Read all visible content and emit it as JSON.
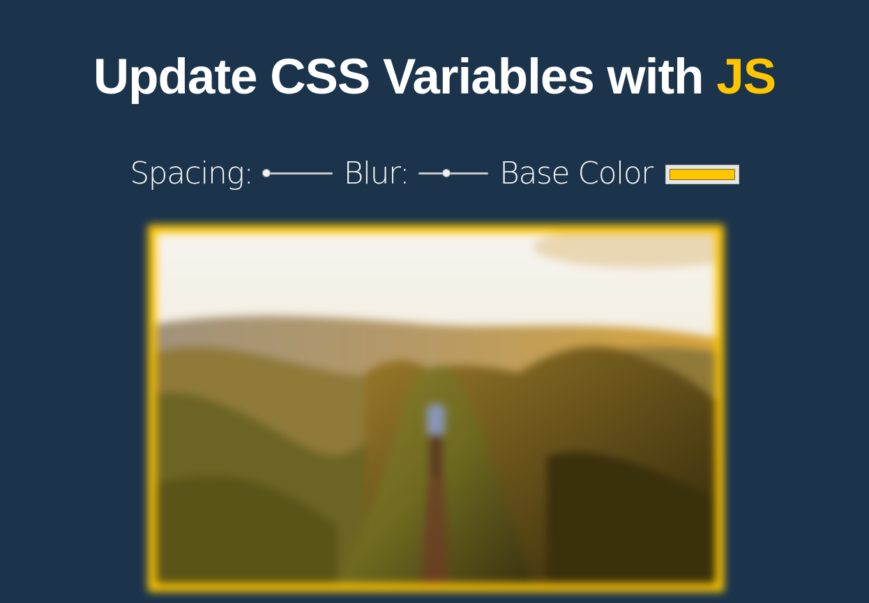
{
  "header": {
    "title_main": "Update CSS Variables with",
    "title_highlight": "JS"
  },
  "controls": {
    "spacing": {
      "label": "Spacing:",
      "value_fraction": 0.05
    },
    "blur": {
      "label": "Blur:",
      "value_fraction": 0.4
    },
    "base_color": {
      "label": "Base Color",
      "value": "#ffc600"
    }
  },
  "photo": {
    "icon": "mountain-landscape-image"
  },
  "colors": {
    "background": "#1b344c",
    "accent": "#ffc600",
    "text": "#ffffff"
  }
}
